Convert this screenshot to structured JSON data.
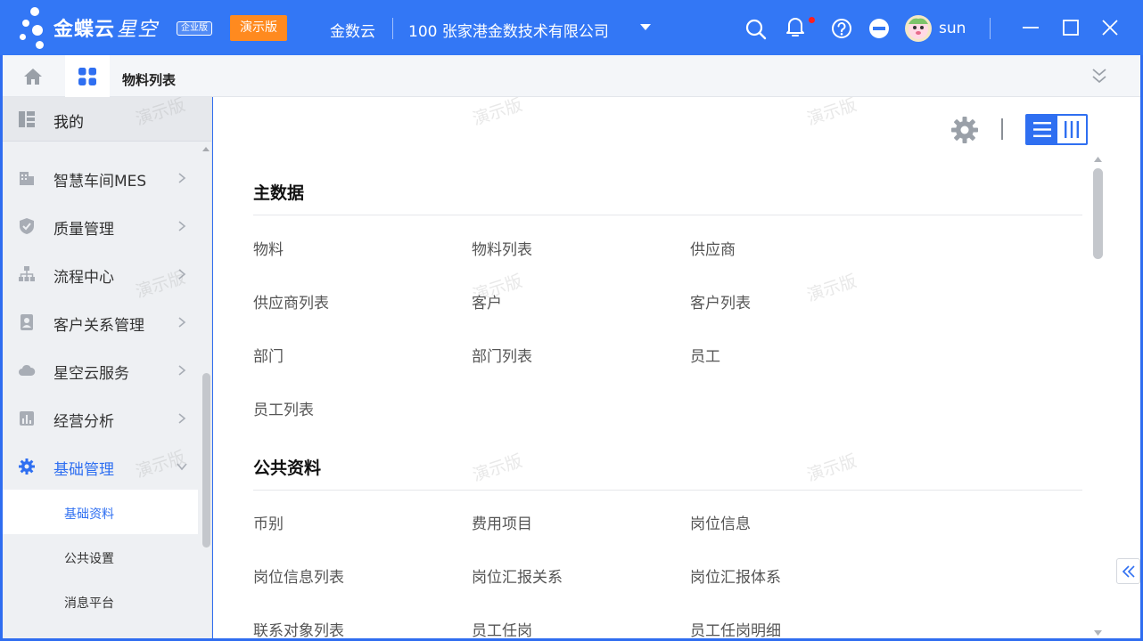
{
  "titlebar": {
    "brand_main": "金蝶云",
    "brand_sub": "星空",
    "edition": "企业版",
    "demo_badge": "演示版",
    "app_name": "金数云",
    "company": "100  张家港金数技术有限公司",
    "username": "sun",
    "notify_dot_color": "#ff1f1f"
  },
  "tabbar": {
    "current_tab": "物料列表"
  },
  "sidebar": {
    "mine": "我的",
    "items": [
      {
        "label": "智慧车间MES",
        "icon": "factory-icon"
      },
      {
        "label": "质量管理",
        "icon": "shield-icon"
      },
      {
        "label": "流程中心",
        "icon": "org-chart-icon"
      },
      {
        "label": "客户关系管理",
        "icon": "contact-card-icon"
      },
      {
        "label": "星空云服务",
        "icon": "cloud-icon"
      },
      {
        "label": "经营分析",
        "icon": "bar-chart-icon"
      },
      {
        "label": "基础管理",
        "icon": "gear-icon"
      }
    ],
    "subitems": [
      "基础资料",
      "公共设置",
      "消息平台"
    ]
  },
  "main": {
    "sections": [
      {
        "title": "主数据",
        "links": [
          "物料",
          "物料列表",
          "供应商",
          "供应商列表",
          "客户",
          "客户列表",
          "部门",
          "部门列表",
          "员工",
          "员工列表"
        ]
      },
      {
        "title": "公共资料",
        "links": [
          "币别",
          "费用项目",
          "岗位信息",
          "岗位信息列表",
          "岗位汇报关系",
          "岗位汇报体系",
          "联系对象列表",
          "员工任岗",
          "员工任岗明细"
        ]
      }
    ],
    "watermark": "演示版"
  },
  "colors": {
    "titlebar": "#3377f5",
    "accent": "#2f6ff1",
    "demo_badge": "#ff8a1f"
  }
}
